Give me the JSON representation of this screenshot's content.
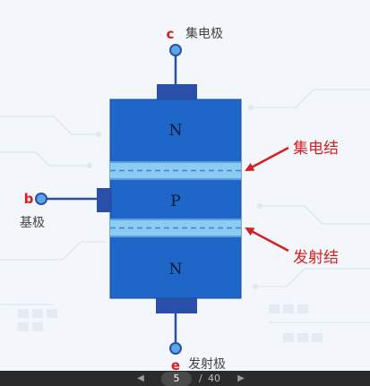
{
  "terminals": {
    "collector": {
      "letter": "c",
      "name": "集电极"
    },
    "base": {
      "letter": "b",
      "name": "基极"
    },
    "emitter": {
      "letter": "e",
      "name": "发射极"
    }
  },
  "regions": {
    "top": "N",
    "middle": "P",
    "bottom": "N"
  },
  "callouts": {
    "collector_junction": "集电结",
    "emitter_junction": "发射结"
  },
  "pager": {
    "prev_icon": "chevron-left-icon",
    "next_icon": "chevron-right-icon",
    "current": "5",
    "separator": "/",
    "total": "40"
  },
  "colors": {
    "body_blue": "#1f66c9",
    "junction": "#8ccbf2",
    "lead": "#2a4fa8",
    "label_red": "#d42020"
  }
}
